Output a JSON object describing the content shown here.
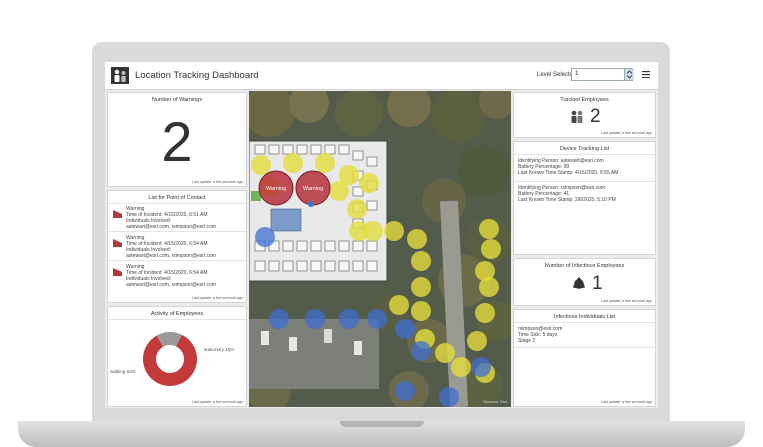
{
  "app": {
    "title": "Location Tracking Dashboard"
  },
  "level_selector": {
    "label": "Level Selector",
    "value": "1"
  },
  "warnings": {
    "title": "Number of Warnings",
    "count": "2",
    "updated": "Last update: a few seconds ago"
  },
  "contacts": {
    "title": "List for Point of Contact",
    "items": [
      {
        "lines": "Warning\nTime of Incident: 4/15/2020, 6:51 AM\nIndividuals Involved:\nastewart@esri.com, rsimpson@esri.com"
      },
      {
        "lines": "Warning\nTime of Incident: 4/15/2020, 6:54 AM\nIndividuals Involved:\nastewart@esri.com, rsimpson@esri.com"
      },
      {
        "lines": "Warning\nTime of Incident: 4/15/2020, 6:54 AM\nIndividuals Involved:\nastewart@esri.com, rsimpson@esri.com"
      }
    ],
    "updated": "Last update: a few seconds ago"
  },
  "activity": {
    "title": "Activity of Employees",
    "updated": "Last update: a few seconds ago",
    "slices": [
      {
        "label": "walking 83%",
        "value": 83,
        "color": "#c23a3a"
      },
      {
        "label": "stationary 15%",
        "value": 15,
        "color": "#9a9a9a"
      }
    ]
  },
  "tracked": {
    "title": "Tracked Employees",
    "count": "2",
    "updated": "Last update: a few seconds ago"
  },
  "devices": {
    "title": "Device Tracking List",
    "items": [
      {
        "lines": "Identifying Person: astewart@esri.com\nBattery Percentage: 99\nLast Known Time Stamp: 4/15/2020, 6:55 AM"
      },
      {
        "lines": "Identifying Person: rsimpson@esri.com\nBattery Percentage: 41\nLast Known Time Stamp: 2/6/2020, 5:10 PM"
      }
    ]
  },
  "infectious": {
    "title": "Number of Infectious Employees",
    "count": "1",
    "updated": "Last update: a few seconds ago"
  },
  "infected_list": {
    "title": "Infectious Individuals List",
    "item": "rsimpson@esri.com\nTime Sick: 5 days\nStage 2",
    "updated": "Last update: a few seconds ago"
  },
  "map": {
    "warning_label": "Warning",
    "attribution": "Sources: Esri",
    "colors": {
      "warning": "#b6303a",
      "yellow": "#e4dc3c",
      "blue": "#3e6fd2"
    }
  }
}
